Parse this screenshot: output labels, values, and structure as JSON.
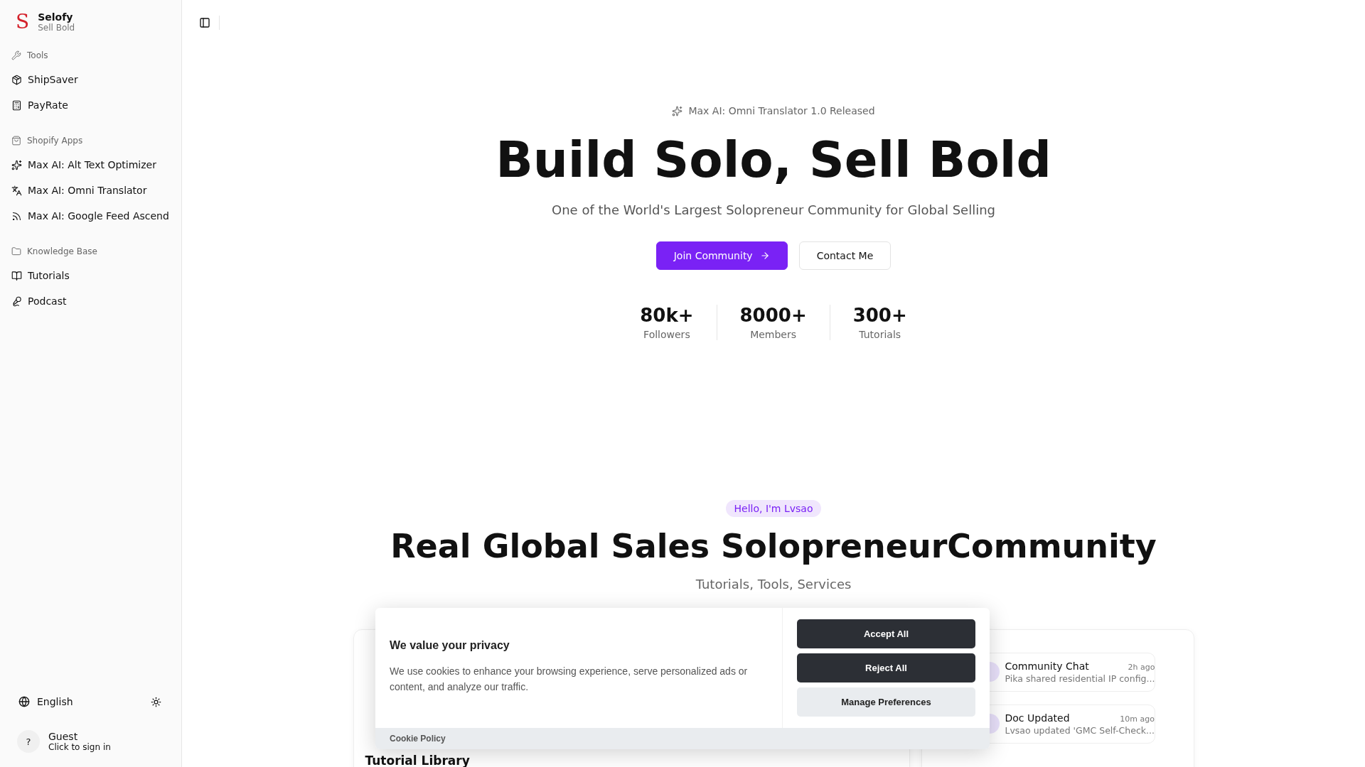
{
  "brand": {
    "name": "Selofy",
    "tagline": "Sell Bold",
    "logo": "S"
  },
  "sidebar": {
    "groups": [
      {
        "label": "Tools",
        "items": [
          "ShipSaver",
          "PayRate"
        ]
      },
      {
        "label": "Shopify Apps",
        "items": [
          "Max AI: Alt Text Optimizer",
          "Max AI: Omni Translator",
          "Max AI: Google Feed Ascend"
        ]
      },
      {
        "label": "Knowledge Base",
        "items": [
          "Tutorials",
          "Podcast"
        ]
      }
    ],
    "language": "English",
    "user": {
      "avatar": "?",
      "name": "Guest",
      "hint": "Click to sign in"
    }
  },
  "hero": {
    "badge": "Max AI: Omni Translator 1.0 Released",
    "title": "Build Solo, Sell Bold",
    "subtitle": "One of the World's Largest Solopreneur Community for Global Selling",
    "buttons": [
      {
        "label": "Join Community",
        "kind": "primary"
      },
      {
        "label": "Contact Me",
        "kind": "outline"
      }
    ],
    "stats": [
      {
        "value": "80k+",
        "label": "Followers"
      },
      {
        "value": "8000+",
        "label": "Members"
      },
      {
        "value": "300+",
        "label": "Tutorials"
      }
    ]
  },
  "about": {
    "pill": "Hello, I'm Lvsao",
    "title": "Real Global Sales SolopreneurCommunity",
    "subtitle": "Tutorials, Tools, Services",
    "library_title": "Tutorial Library",
    "activity": [
      {
        "title": "Community Chat",
        "time": "2h ago",
        "text": "Pika shared residential IP config..."
      },
      {
        "title": "Doc Updated",
        "time": "10m ago",
        "text": "Lvsao updated 'GMC Self-Check..."
      }
    ]
  },
  "cookie_banner": {
    "title": "We value your privacy",
    "text": "We use cookies to enhance your browsing experience, serve personalized ads or content, and analyze our traffic.",
    "buttons": [
      {
        "label": "Accept All",
        "kind": "dark"
      },
      {
        "label": "Reject All",
        "kind": "dark"
      },
      {
        "label": "Manage Preferences",
        "kind": "light"
      }
    ],
    "footer_link": "Cookie Policy"
  }
}
